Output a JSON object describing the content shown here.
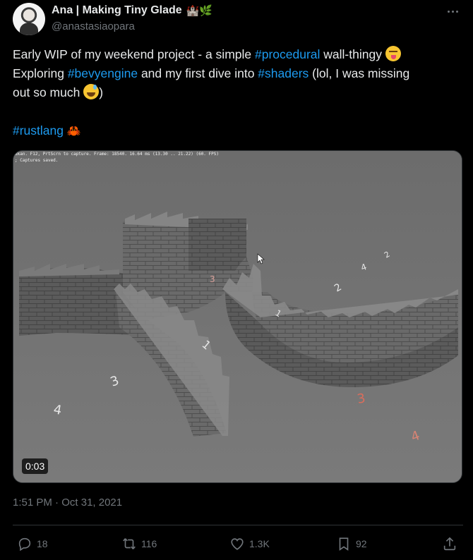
{
  "author": {
    "display_name": "Ana | Making Tiny Glade",
    "badge_emoji": "🏰🌿",
    "handle": "@anastasiaopara"
  },
  "tweet": {
    "line1_before": "Early WIP of my weekend project - a simple ",
    "line1_tag": "#procedural",
    "line1_after": " wall-thingy ",
    "line2_before": "Exploring  ",
    "line2_tag1": "#bevyengine",
    "line2_mid": " and my first dive into ",
    "line2_tag2": "#shaders",
    "line2_after": " (lol, I was missing",
    "line3_before": "out so much ",
    "line3_after": ")",
    "line4_tag": "#rustlang",
    "line4_emoji": "🦀"
  },
  "media": {
    "debug_line1": "ukan. F12, PrtScrn to capture. Frame: 18540. 16.64 ms (13.30 .. 21.22) (60. FPS)",
    "debug_line2": "; Captures saved.",
    "duration": "0:03",
    "ground_numbers": [
      "3",
      "4",
      "3",
      "2",
      "1",
      "3",
      "4",
      "1",
      "2",
      "4"
    ]
  },
  "meta": {
    "time": "1:51 PM",
    "separator": "·",
    "date": "Oct 31, 2021"
  },
  "actions": {
    "replies": "18",
    "reposts": "116",
    "likes": "1.3K",
    "bookmarks": "92"
  },
  "icons": [
    "more-icon",
    "reply-icon",
    "repost-icon",
    "like-icon",
    "bookmark-icon",
    "share-icon"
  ]
}
